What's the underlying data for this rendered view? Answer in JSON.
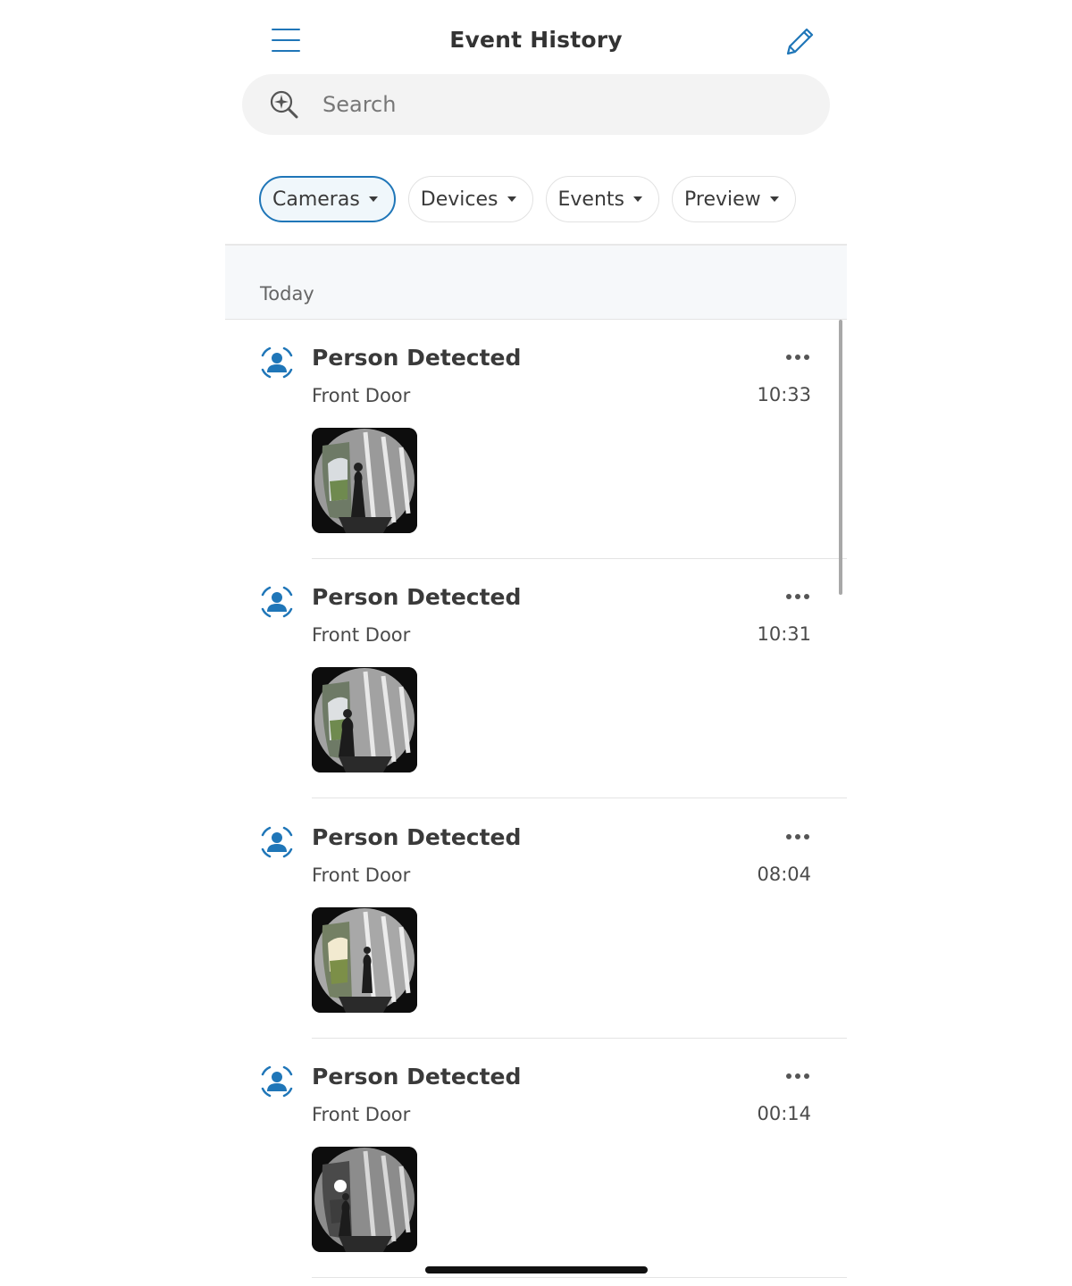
{
  "header": {
    "title": "Event History",
    "menu_icon": "hamburger-menu-icon",
    "edit_icon": "pencil-icon",
    "accent_color": "#1f76b8"
  },
  "search": {
    "placeholder": "Search",
    "value": "",
    "icon": "sparkle-search-icon"
  },
  "filters": [
    {
      "label": "Cameras",
      "active": true
    },
    {
      "label": "Devices",
      "active": false
    },
    {
      "label": "Events",
      "active": false
    },
    {
      "label": "Preview",
      "active": false
    }
  ],
  "section": {
    "label": "Today"
  },
  "events": [
    {
      "title": "Person Detected",
      "device": "Front Door",
      "time": "10:33",
      "icon": "person-detection-icon",
      "more_icon": "more-dots-icon"
    },
    {
      "title": "Person Detected",
      "device": "Front Door",
      "time": "10:31",
      "icon": "person-detection-icon",
      "more_icon": "more-dots-icon"
    },
    {
      "title": "Person Detected",
      "device": "Front Door",
      "time": "08:04",
      "icon": "person-detection-icon",
      "more_icon": "more-dots-icon"
    },
    {
      "title": "Person Detected",
      "device": "Front Door",
      "time": "00:14",
      "icon": "person-detection-icon",
      "more_icon": "more-dots-icon"
    }
  ]
}
